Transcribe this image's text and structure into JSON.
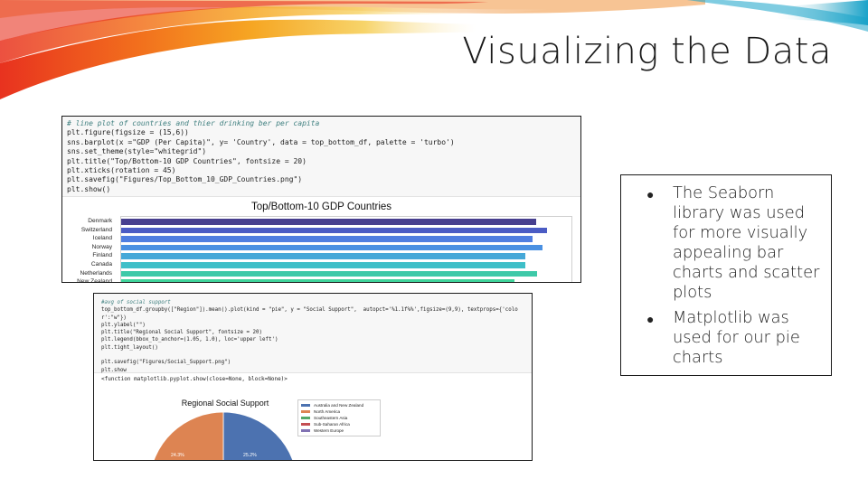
{
  "slide": {
    "title": "Visualizing the Data"
  },
  "screenshot1": {
    "code_comment": "# line plot of countries and thier drinking ber per capita",
    "code_lines": [
      "plt.figure(figsize = (15,6))",
      "sns.barplot(x =\"GDP (Per Capita)\", y= 'Country', data = top_bottom_df, palette = 'turbo')",
      "sns.set_theme(style=\"whitegrid\")",
      "plt.title(\"Top/Bottom-10 GDP Countries\", fontsize = 20)",
      "plt.xticks(rotation = 45)",
      "plt.savefig(\"Figures/Top_Bottom_10_GDP_Countries.png\")",
      "plt.show()"
    ]
  },
  "chart_data": [
    {
      "type": "bar",
      "title": "Top/Bottom-10 GDP Countries",
      "orientation": "horizontal",
      "categories": [
        "Denmark",
        "Switzerland",
        "Iceland",
        "Norway",
        "Finland",
        "Canada",
        "Netherlands",
        "New Zealand"
      ],
      "values": [
        1.383,
        1.42,
        1.37,
        1.405,
        1.345,
        1.345,
        1.385,
        1.31
      ],
      "xlim": [
        0,
        1.5
      ],
      "colors": [
        "#473f8f",
        "#4b5cc4",
        "#4f7ee0",
        "#4a90e2",
        "#46a8d8",
        "#3fbfc8",
        "#3ec9a8",
        "#3ed39a"
      ]
    },
    {
      "type": "pie",
      "title": "Regional Social Support",
      "labels": [
        "Australia and New Zealand",
        "North America",
        "Southeastern Asia",
        "Sub-Saharan Africa",
        "Western Europe"
      ],
      "values": [
        25.2,
        24.3,
        null,
        null,
        null
      ],
      "value_labels": [
        "25.2%",
        "24.3%"
      ],
      "colors": [
        "#4c72b0",
        "#dd8452",
        "#55a868",
        "#c44e52",
        "#8172b3"
      ]
    }
  ],
  "screenshot2": {
    "code_comment": "#avg of social support",
    "code_lines": [
      "top_bottom_df.groupby([\"Region\"]).mean().plot(kind = \"pie\", y = \"Social Support\",  autopct='%1.1f%%',figsize=(9,9), textprops={'colo",
      "r':\"w\"})",
      "plt.ylabel(\"\")",
      "plt.title(\"Regional Social Support\", fontsize = 20)",
      "plt.legend(bbox_to_anchor=(1.05, 1.0), loc='upper left')",
      "plt.tight_layout()",
      "",
      "plt.savefig(\"Figures/Social_Support.png\")",
      "plt.show"
    ],
    "output": "<function matplotlib.pyplot.show(close=None, block=None)>"
  },
  "info_box": {
    "bullets": [
      "The Seaborn library was used for more visually appealing bar charts and scatter plots",
      "Matplotlib was used for our pie charts"
    ]
  }
}
